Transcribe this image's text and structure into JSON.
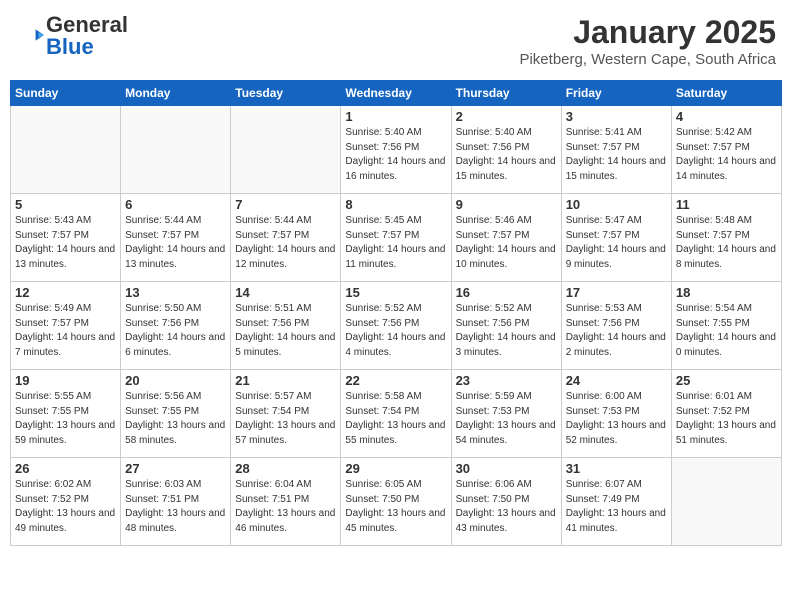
{
  "header": {
    "logo_general": "General",
    "logo_blue": "Blue",
    "month": "January 2025",
    "location": "Piketberg, Western Cape, South Africa"
  },
  "days_of_week": [
    "Sunday",
    "Monday",
    "Tuesday",
    "Wednesday",
    "Thursday",
    "Friday",
    "Saturday"
  ],
  "weeks": [
    [
      {
        "day": "",
        "sunrise": "",
        "sunset": "",
        "daylight": ""
      },
      {
        "day": "",
        "sunrise": "",
        "sunset": "",
        "daylight": ""
      },
      {
        "day": "",
        "sunrise": "",
        "sunset": "",
        "daylight": ""
      },
      {
        "day": "1",
        "sunrise": "Sunrise: 5:40 AM",
        "sunset": "Sunset: 7:56 PM",
        "daylight": "Daylight: 14 hours and 16 minutes."
      },
      {
        "day": "2",
        "sunrise": "Sunrise: 5:40 AM",
        "sunset": "Sunset: 7:56 PM",
        "daylight": "Daylight: 14 hours and 15 minutes."
      },
      {
        "day": "3",
        "sunrise": "Sunrise: 5:41 AM",
        "sunset": "Sunset: 7:57 PM",
        "daylight": "Daylight: 14 hours and 15 minutes."
      },
      {
        "day": "4",
        "sunrise": "Sunrise: 5:42 AM",
        "sunset": "Sunset: 7:57 PM",
        "daylight": "Daylight: 14 hours and 14 minutes."
      }
    ],
    [
      {
        "day": "5",
        "sunrise": "Sunrise: 5:43 AM",
        "sunset": "Sunset: 7:57 PM",
        "daylight": "Daylight: 14 hours and 13 minutes."
      },
      {
        "day": "6",
        "sunrise": "Sunrise: 5:44 AM",
        "sunset": "Sunset: 7:57 PM",
        "daylight": "Daylight: 14 hours and 13 minutes."
      },
      {
        "day": "7",
        "sunrise": "Sunrise: 5:44 AM",
        "sunset": "Sunset: 7:57 PM",
        "daylight": "Daylight: 14 hours and 12 minutes."
      },
      {
        "day": "8",
        "sunrise": "Sunrise: 5:45 AM",
        "sunset": "Sunset: 7:57 PM",
        "daylight": "Daylight: 14 hours and 11 minutes."
      },
      {
        "day": "9",
        "sunrise": "Sunrise: 5:46 AM",
        "sunset": "Sunset: 7:57 PM",
        "daylight": "Daylight: 14 hours and 10 minutes."
      },
      {
        "day": "10",
        "sunrise": "Sunrise: 5:47 AM",
        "sunset": "Sunset: 7:57 PM",
        "daylight": "Daylight: 14 hours and 9 minutes."
      },
      {
        "day": "11",
        "sunrise": "Sunrise: 5:48 AM",
        "sunset": "Sunset: 7:57 PM",
        "daylight": "Daylight: 14 hours and 8 minutes."
      }
    ],
    [
      {
        "day": "12",
        "sunrise": "Sunrise: 5:49 AM",
        "sunset": "Sunset: 7:57 PM",
        "daylight": "Daylight: 14 hours and 7 minutes."
      },
      {
        "day": "13",
        "sunrise": "Sunrise: 5:50 AM",
        "sunset": "Sunset: 7:56 PM",
        "daylight": "Daylight: 14 hours and 6 minutes."
      },
      {
        "day": "14",
        "sunrise": "Sunrise: 5:51 AM",
        "sunset": "Sunset: 7:56 PM",
        "daylight": "Daylight: 14 hours and 5 minutes."
      },
      {
        "day": "15",
        "sunrise": "Sunrise: 5:52 AM",
        "sunset": "Sunset: 7:56 PM",
        "daylight": "Daylight: 14 hours and 4 minutes."
      },
      {
        "day": "16",
        "sunrise": "Sunrise: 5:52 AM",
        "sunset": "Sunset: 7:56 PM",
        "daylight": "Daylight: 14 hours and 3 minutes."
      },
      {
        "day": "17",
        "sunrise": "Sunrise: 5:53 AM",
        "sunset": "Sunset: 7:56 PM",
        "daylight": "Daylight: 14 hours and 2 minutes."
      },
      {
        "day": "18",
        "sunrise": "Sunrise: 5:54 AM",
        "sunset": "Sunset: 7:55 PM",
        "daylight": "Daylight: 14 hours and 0 minutes."
      }
    ],
    [
      {
        "day": "19",
        "sunrise": "Sunrise: 5:55 AM",
        "sunset": "Sunset: 7:55 PM",
        "daylight": "Daylight: 13 hours and 59 minutes."
      },
      {
        "day": "20",
        "sunrise": "Sunrise: 5:56 AM",
        "sunset": "Sunset: 7:55 PM",
        "daylight": "Daylight: 13 hours and 58 minutes."
      },
      {
        "day": "21",
        "sunrise": "Sunrise: 5:57 AM",
        "sunset": "Sunset: 7:54 PM",
        "daylight": "Daylight: 13 hours and 57 minutes."
      },
      {
        "day": "22",
        "sunrise": "Sunrise: 5:58 AM",
        "sunset": "Sunset: 7:54 PM",
        "daylight": "Daylight: 13 hours and 55 minutes."
      },
      {
        "day": "23",
        "sunrise": "Sunrise: 5:59 AM",
        "sunset": "Sunset: 7:53 PM",
        "daylight": "Daylight: 13 hours and 54 minutes."
      },
      {
        "day": "24",
        "sunrise": "Sunrise: 6:00 AM",
        "sunset": "Sunset: 7:53 PM",
        "daylight": "Daylight: 13 hours and 52 minutes."
      },
      {
        "day": "25",
        "sunrise": "Sunrise: 6:01 AM",
        "sunset": "Sunset: 7:52 PM",
        "daylight": "Daylight: 13 hours and 51 minutes."
      }
    ],
    [
      {
        "day": "26",
        "sunrise": "Sunrise: 6:02 AM",
        "sunset": "Sunset: 7:52 PM",
        "daylight": "Daylight: 13 hours and 49 minutes."
      },
      {
        "day": "27",
        "sunrise": "Sunrise: 6:03 AM",
        "sunset": "Sunset: 7:51 PM",
        "daylight": "Daylight: 13 hours and 48 minutes."
      },
      {
        "day": "28",
        "sunrise": "Sunrise: 6:04 AM",
        "sunset": "Sunset: 7:51 PM",
        "daylight": "Daylight: 13 hours and 46 minutes."
      },
      {
        "day": "29",
        "sunrise": "Sunrise: 6:05 AM",
        "sunset": "Sunset: 7:50 PM",
        "daylight": "Daylight: 13 hours and 45 minutes."
      },
      {
        "day": "30",
        "sunrise": "Sunrise: 6:06 AM",
        "sunset": "Sunset: 7:50 PM",
        "daylight": "Daylight: 13 hours and 43 minutes."
      },
      {
        "day": "31",
        "sunrise": "Sunrise: 6:07 AM",
        "sunset": "Sunset: 7:49 PM",
        "daylight": "Daylight: 13 hours and 41 minutes."
      },
      {
        "day": "",
        "sunrise": "",
        "sunset": "",
        "daylight": ""
      }
    ]
  ]
}
